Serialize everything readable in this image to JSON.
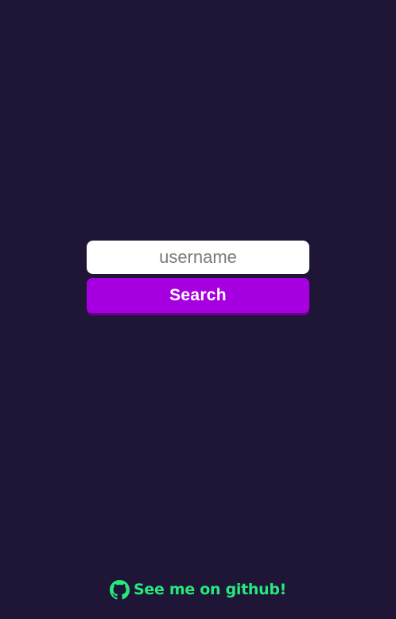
{
  "search_form": {
    "username_placeholder": "username",
    "username_value": "",
    "search_label": "Search"
  },
  "footer": {
    "icon": "github-icon",
    "link_text": "See me on github!"
  },
  "colors": {
    "background": "#1e1537",
    "button": "#a700e0",
    "accent_green": "#27e87c"
  }
}
